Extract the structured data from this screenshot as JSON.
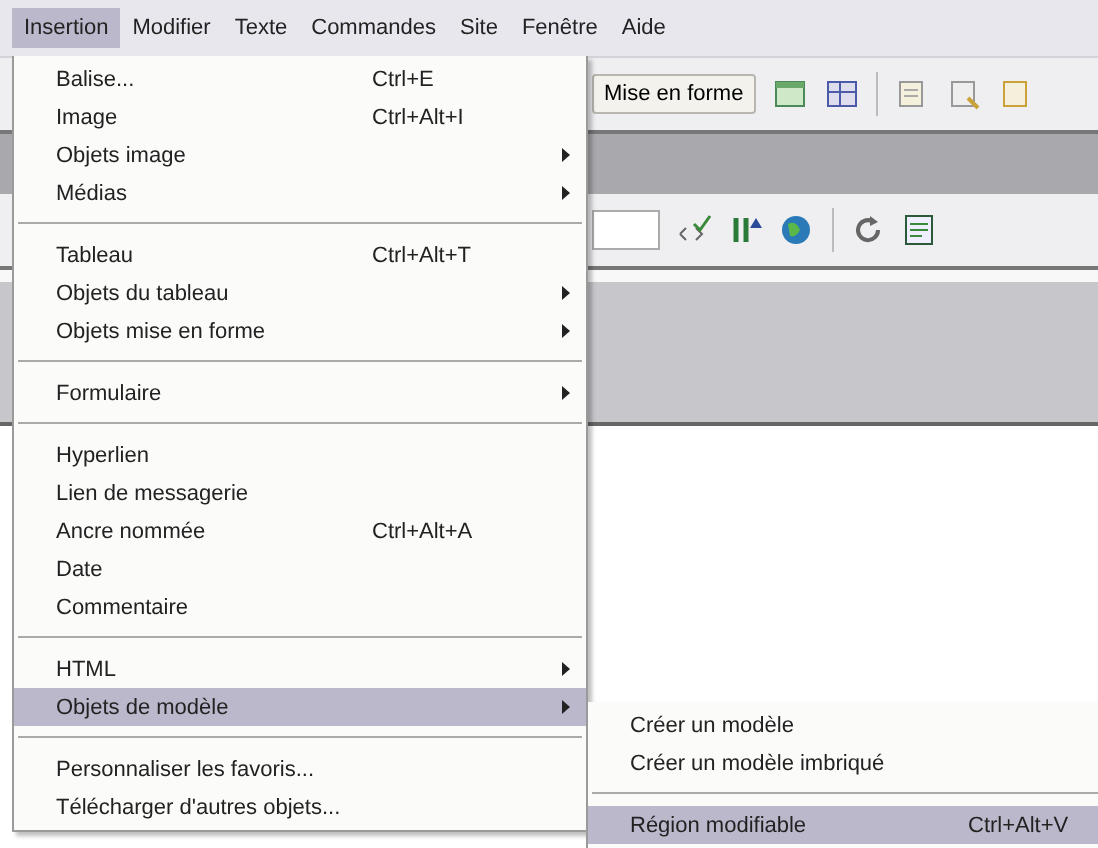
{
  "menubar": [
    {
      "label": "Insertion",
      "selected": true
    },
    {
      "label": "Modifier",
      "selected": false
    },
    {
      "label": "Texte",
      "selected": false
    },
    {
      "label": "Commandes",
      "selected": false
    },
    {
      "label": "Site",
      "selected": false
    },
    {
      "label": "Fenêtre",
      "selected": false
    },
    {
      "label": "Aide",
      "selected": false
    }
  ],
  "toolbar": {
    "button": "Mise en forme"
  },
  "menu": [
    {
      "kind": "item",
      "label": "Balise...",
      "shortcut": "Ctrl+E",
      "submenu": false,
      "selected": false
    },
    {
      "kind": "item",
      "label": "Image",
      "shortcut": "Ctrl+Alt+I",
      "submenu": false,
      "selected": false
    },
    {
      "kind": "item",
      "label": "Objets image",
      "submenu": true,
      "selected": false
    },
    {
      "kind": "item",
      "label": "Médias",
      "submenu": true,
      "selected": false
    },
    {
      "kind": "separator"
    },
    {
      "kind": "item",
      "label": "Tableau",
      "shortcut": "Ctrl+Alt+T",
      "submenu": false,
      "selected": false
    },
    {
      "kind": "item",
      "label": "Objets du tableau",
      "submenu": true,
      "selected": false
    },
    {
      "kind": "item",
      "label": "Objets mise en forme",
      "submenu": true,
      "selected": false
    },
    {
      "kind": "separator"
    },
    {
      "kind": "item",
      "label": "Formulaire",
      "submenu": true,
      "selected": false
    },
    {
      "kind": "separator"
    },
    {
      "kind": "item",
      "label": "Hyperlien",
      "submenu": false,
      "selected": false
    },
    {
      "kind": "item",
      "label": "Lien de messagerie",
      "submenu": false,
      "selected": false
    },
    {
      "kind": "item",
      "label": "Ancre nommée",
      "shortcut": "Ctrl+Alt+A",
      "submenu": false,
      "selected": false
    },
    {
      "kind": "item",
      "label": "Date",
      "submenu": false,
      "selected": false
    },
    {
      "kind": "item",
      "label": "Commentaire",
      "submenu": false,
      "selected": false
    },
    {
      "kind": "separator"
    },
    {
      "kind": "item",
      "label": "HTML",
      "submenu": true,
      "selected": false
    },
    {
      "kind": "item",
      "label": "Objets de modèle",
      "submenu": true,
      "selected": true
    },
    {
      "kind": "separator"
    },
    {
      "kind": "item",
      "label": "Personnaliser les favoris...",
      "submenu": false,
      "selected": false
    },
    {
      "kind": "item",
      "label": "Télécharger d'autres objets...",
      "submenu": false,
      "selected": false
    }
  ],
  "submenu": [
    {
      "kind": "item",
      "label": "Créer un modèle",
      "selected": false
    },
    {
      "kind": "item",
      "label": "Créer un modèle imbriqué",
      "selected": false
    },
    {
      "kind": "separator"
    },
    {
      "kind": "item",
      "label": "Région modifiable",
      "shortcut": "Ctrl+Alt+V",
      "selected": true
    }
  ]
}
